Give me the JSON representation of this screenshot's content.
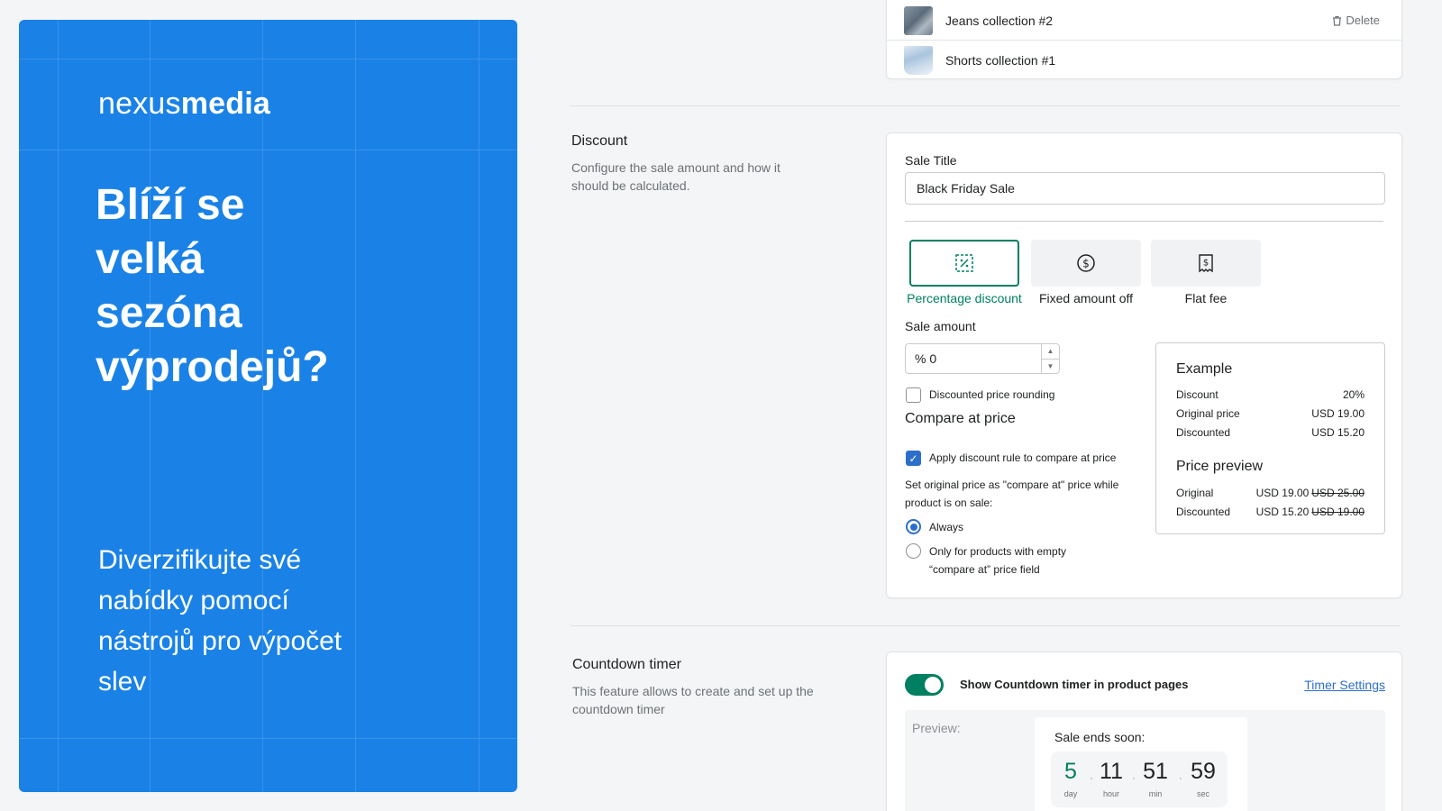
{
  "promo": {
    "logo_light": "nexus",
    "logo_bold": "media",
    "headline": [
      "Blíží se",
      "velká",
      "sezóna",
      "výprodejů?"
    ],
    "subline": [
      "Diverzifikujte své",
      "nabídky pomocí",
      "nástrojů pro výpočet",
      "slev"
    ]
  },
  "collections": {
    "items": [
      {
        "name": "Jeans collection #2",
        "thumb": "jeans-image"
      },
      {
        "name": "Shorts collection #1",
        "thumb": "shorts-image"
      }
    ],
    "delete_label": "Delete"
  },
  "discount_section": {
    "title": "Discount",
    "description": "Configure the sale amount and how it should be calculated.",
    "sale_title_label": "Sale Title",
    "sale_title_value": "Black Friday Sale",
    "options": [
      {
        "label": "Percentage discount",
        "icon": "percent-icon",
        "selected": true
      },
      {
        "label": "Fixed amount off",
        "icon": "dollar-circle-icon",
        "selected": false
      },
      {
        "label": "Flat fee",
        "icon": "dollar-tag-icon",
        "selected": false
      }
    ],
    "sale_amount_label": "Sale amount",
    "sale_amount_value": "% 0",
    "rounding_label": "Discounted price rounding",
    "rounding_checked": false,
    "compare_heading": "Compare at price",
    "apply_rule_label": "Apply discount rule to compare at price",
    "apply_rule_checked": true,
    "compare_help": "Set original price as \"compare at\" price while product is on sale:",
    "radio_always": "Always",
    "radio_empty": "Only for products with empty “compare at” price field",
    "selected_radio": "Always"
  },
  "example": {
    "title": "Example",
    "rows": [
      {
        "label": "Discount",
        "value": "20%"
      },
      {
        "label": "Original price",
        "value": "USD 19.00"
      },
      {
        "label": "Discounted",
        "value": "USD 15.20"
      }
    ],
    "preview_title": "Price preview",
    "preview_rows": [
      {
        "label": "Original",
        "value": "USD 19.00",
        "strike": "USD 25.00"
      },
      {
        "label": "Discounted",
        "value": "USD 15.20",
        "strike": "USD 19.00"
      }
    ]
  },
  "countdown_section": {
    "title": "Countdown timer",
    "description": "This feature allows to create and set up the countdown timer",
    "toggle_label": "Show Countdown timer in product pages",
    "toggle_on": true,
    "settings_link": "Timer Settings",
    "preview_label": "Preview:",
    "sale_ends_label": "Sale ends soon:",
    "timer": [
      {
        "value": "5",
        "unit": "day"
      },
      {
        "value": "11",
        "unit": "hour"
      },
      {
        "value": "51",
        "unit": "min"
      },
      {
        "value": "59",
        "unit": "sec"
      }
    ]
  },
  "colors": {
    "promo_blue": "#1a82e6",
    "accent_green": "#008060",
    "link_blue": "#2c6ecb"
  }
}
